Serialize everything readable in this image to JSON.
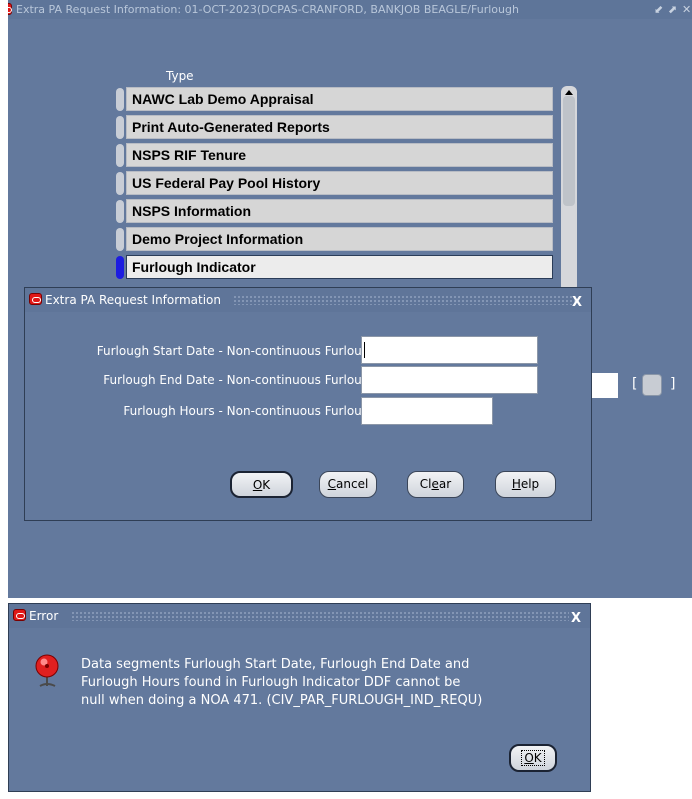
{
  "main_window": {
    "title": "Extra PA Request Information: 01-OCT-2023(DCPAS-CRANFORD, BANKJOB BEAGLE/Furlough",
    "type_header": "Type",
    "types": [
      {
        "label": "NAWC Lab Demo Appraisal",
        "selected": false
      },
      {
        "label": "Print Auto-Generated Reports",
        "selected": false
      },
      {
        "label": "NSPS RIF Tenure",
        "selected": false
      },
      {
        "label": "US Federal Pay Pool History",
        "selected": false
      },
      {
        "label": "NSPS Information",
        "selected": false
      },
      {
        "label": "Demo Project Information",
        "selected": false
      },
      {
        "label": "Furlough Indicator",
        "selected": true
      }
    ],
    "bracket_left": "[",
    "bracket_right": "]"
  },
  "dialog": {
    "title": "Extra PA Request Information",
    "close": "X",
    "fields": [
      {
        "label": "Furlough Start Date - Non-continuous Furlough",
        "value": ""
      },
      {
        "label": "Furlough End Date - Non-continuous Furlough",
        "value": ""
      },
      {
        "label": "Furlough Hours - Non-continuous Furlough",
        "value": ""
      }
    ],
    "buttons": {
      "ok": {
        "mnemonic": "O",
        "rest": "K"
      },
      "cancel": {
        "mnemonic": "C",
        "rest": "ancel"
      },
      "clear": {
        "pre": "Cl",
        "mnemonic": "e",
        "rest": "ar"
      },
      "help": {
        "mnemonic": "H",
        "rest": "elp"
      }
    }
  },
  "error_dialog": {
    "title": "Error",
    "close": "X",
    "message_lines": [
      "Data segments Furlough Start Date, Furlough End Date and",
      "Furlough Hours found in Furlough Indicator DDF cannot be",
      "null when doing a NOA 471. (CIV_PAR_FURLOUGH_IND_REQU)"
    ],
    "ok": {
      "mnemonic": "O",
      "rest": "K"
    }
  },
  "colors": {
    "window_bg": "#63799d",
    "selected_indicator": "#1c1ce0",
    "oracle_icon": "#e01818"
  }
}
